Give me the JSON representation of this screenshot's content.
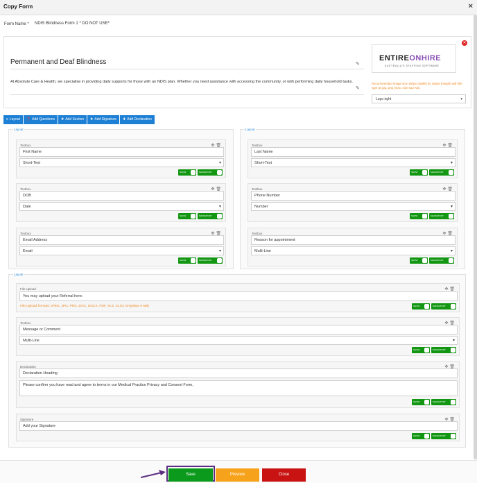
{
  "dialog": {
    "title": "Copy Form",
    "close": "×"
  },
  "form_name": {
    "label": "Form Name *",
    "value": "NDIS Blindness Form 1 * DO NOT USE*"
  },
  "header": {
    "title": "Permanent and Deaf Blindness",
    "description": "At Absolute Care & Health, we specialise in providing daily supports for those with an NDIS plan. Whether you need assistance with accessing the community, or with performing daily household tasks."
  },
  "logo": {
    "part1": "ENTIRE",
    "part2": "ONHIRE",
    "tagline": "AUSTRALIA'S STAFFING SOFTWARE",
    "hint": "Recommended image size 350px (width) by 150px (height) with file type as jpg, png (max. size 512 KB).",
    "position": "Logo right"
  },
  "toolbar": [
    {
      "icon": "≡",
      "label": "Layout"
    },
    {
      "icon": "❓",
      "label": "Add Questions"
    },
    {
      "icon": "✚",
      "label": "Add Section"
    },
    {
      "icon": "✚",
      "label": "Add Signature"
    },
    {
      "icon": "✚",
      "label": "Add Declaration"
    }
  ],
  "layout_label": "Layout",
  "toggle_labels": {
    "show": "SHOW",
    "mandatory": "MANDATORY"
  },
  "icons": {
    "move": "✥",
    "delete": "🗑",
    "caret": "▾",
    "pencil": "✎"
  },
  "fields_left": [
    {
      "type": "Textbox",
      "label": "First Name",
      "subtype": "Short-Text"
    },
    {
      "type": "Textbox",
      "label": "DOB",
      "subtype": "Date"
    },
    {
      "type": "Textbox",
      "label": "Email Address",
      "subtype": "Email"
    }
  ],
  "fields_right": [
    {
      "type": "Textbox",
      "label": "Last Name",
      "subtype": "Short-Text"
    },
    {
      "type": "Textbox",
      "label": "Phone Number",
      "subtype": "Number"
    },
    {
      "type": "Textbox",
      "label": "Reason for appointment",
      "subtype": "Multi-Line"
    }
  ],
  "file_upload": {
    "type": "File Upload",
    "label": "You may upload your Referral here.",
    "hint": "File Upload formats: JPEG, JPG, PNG, DOC, DOCX, PDF, XLS, XLSX Only(Max 5 MB)"
  },
  "message": {
    "type": "Textbox",
    "label": "Message or Comment",
    "subtype": "Multi-Line"
  },
  "declaration": {
    "type": "Declaration",
    "heading": "Declaration Heading",
    "text": "Please confirm you have read and agree to terms in our Medical Practice Privacy and Consent Form,"
  },
  "signature": {
    "type": "Signature",
    "label": "Add your Signature"
  },
  "footer": {
    "save": "Save",
    "preview": "Preview",
    "close": "Close"
  },
  "colors": {
    "primary": "#1e80d4",
    "toggle": "#139713",
    "save": "#0c9a1c",
    "preview": "#f7a21b",
    "close": "#c91313",
    "highlight": "#5a2d82",
    "warning": "#f08a24"
  }
}
